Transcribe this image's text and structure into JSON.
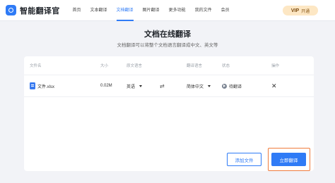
{
  "app": {
    "logo_text": "智能翻译官",
    "nav": [
      "首页",
      "文本翻译",
      "文档翻译",
      "图片翻译",
      "更多功能",
      "我的文件",
      "会员"
    ],
    "active_nav": 2,
    "vip": {
      "badge": "VIP",
      "label": "开通"
    }
  },
  "page": {
    "title": "文档在线翻译",
    "subtitle": "文档翻译可以将整个文档语言翻译成中文、英文等"
  },
  "table": {
    "headers": [
      "文件名",
      "大小",
      "原文语言",
      "翻译语言",
      "状态",
      "操作"
    ],
    "rows": [
      {
        "file_name": "文件.xlsx",
        "size": "0.02M",
        "source_lang": "英语",
        "target_lang": "简体中文",
        "status": "待翻译"
      }
    ]
  },
  "actions": {
    "add_file": "添加文件",
    "translate_now": "立即翻译"
  },
  "colors": {
    "accent": "#2f7bf6",
    "highlight_border": "#f07c3c",
    "background": "#f2f3f7"
  },
  "icons": [
    "logo-icon",
    "file-icon",
    "chevron-down-icon",
    "swap-icon",
    "play-icon",
    "close-icon"
  ]
}
